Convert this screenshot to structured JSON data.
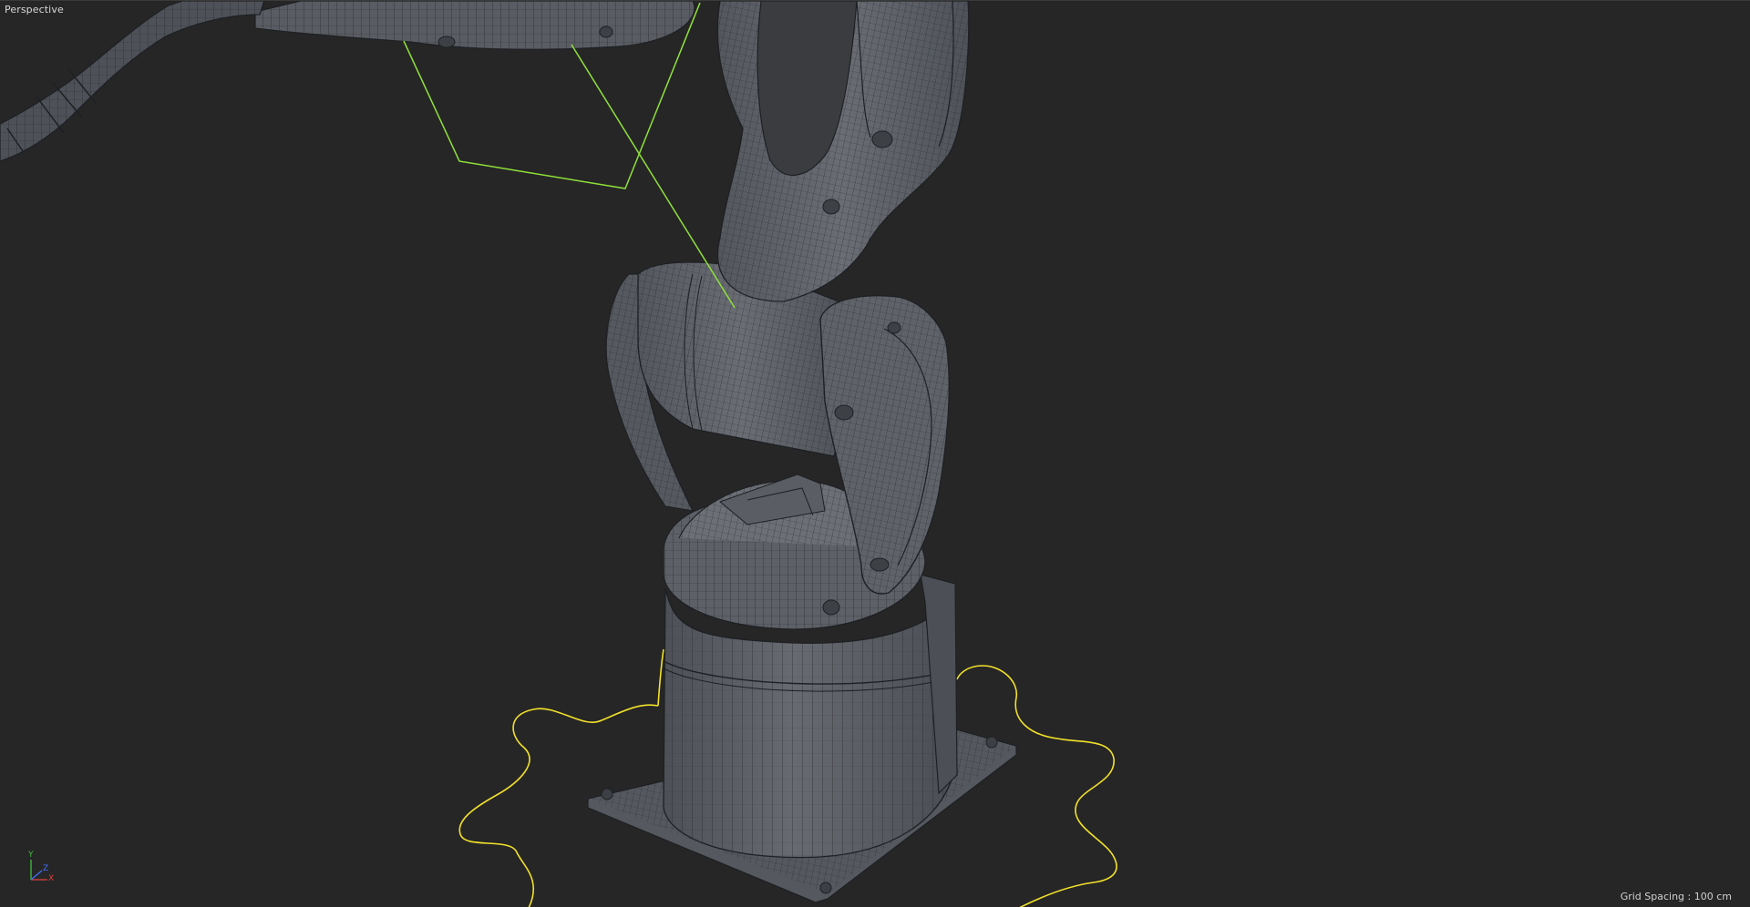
{
  "viewport": {
    "view_name": "Perspective",
    "grid_spacing": "Grid Spacing : 100 cm",
    "axes": {
      "y_label": "Y",
      "z_label": "Z",
      "x_label": "X"
    }
  },
  "colors": {
    "background": "#262626",
    "mesh_fill": "#5b5e64",
    "mesh_wire": "#1e2024",
    "selection_green": "#8fe13a",
    "spline_yellow": "#f2e12a",
    "axis_x": "#e04040",
    "axis_y": "#40c040",
    "axis_z": "#4070ff"
  }
}
